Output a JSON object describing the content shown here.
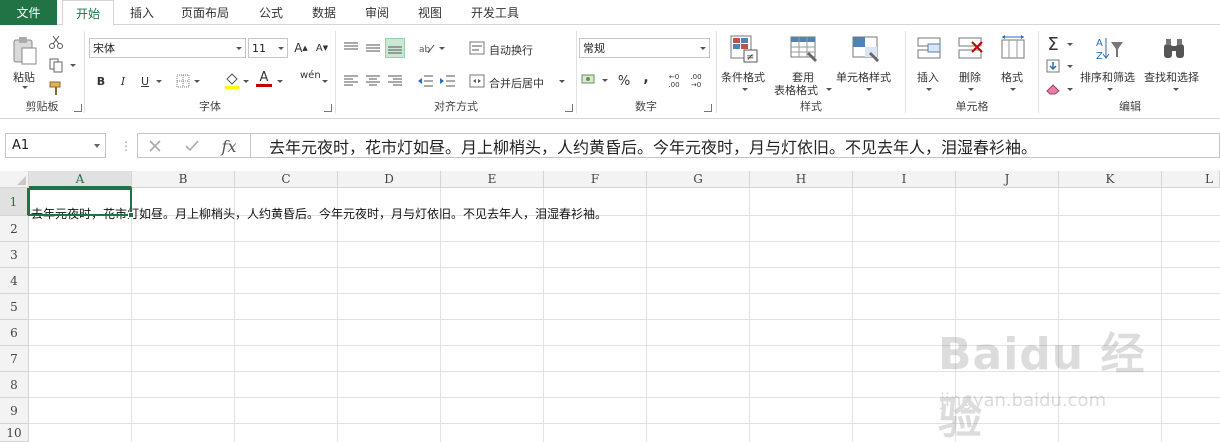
{
  "tabs": {
    "file": "文件",
    "home": "开始",
    "insert": "插入",
    "page_layout": "页面布局",
    "formulas": "公式",
    "data": "数据",
    "review": "审阅",
    "view": "视图",
    "developer": "开发工具"
  },
  "clipboard": {
    "paste": "粘贴",
    "group": "剪贴板"
  },
  "font": {
    "name": "宋体",
    "size": "11",
    "bold": "B",
    "italic": "I",
    "underline": "U",
    "grow": "A",
    "shrink": "A",
    "font_color": "A",
    "phonetic": "wén",
    "group": "字体"
  },
  "alignment": {
    "wrap": "自动换行",
    "merge": "合并后居中",
    "group": "对齐方式"
  },
  "number": {
    "format": "常规",
    "percent": "%",
    "comma": ",",
    "inc_decimal": ".00",
    "dec_decimal": ".00",
    "group": "数字"
  },
  "styles": {
    "conditional": "条件格式",
    "table_line1": "套用",
    "table_line2": "表格格式",
    "cell_styles": "单元格样式",
    "group": "样式"
  },
  "cells": {
    "insert": "插入",
    "delete": "删除",
    "format": "格式",
    "group": "单元格"
  },
  "editing": {
    "sum": "Σ",
    "sort": "排序和筛选",
    "find": "查找和选择",
    "group": "编辑"
  },
  "formula_bar": {
    "name_box": "A1",
    "fx": "fx",
    "content": "去年元夜时，花市灯如昼。月上柳梢头，人约黄昏后。今年元夜时，月与灯依旧。不见去年人，泪湿春衫袖。"
  },
  "grid": {
    "columns": [
      "A",
      "B",
      "C",
      "D",
      "E",
      "F",
      "G",
      "H",
      "I",
      "J",
      "K",
      "L"
    ],
    "rows": [
      "1",
      "2",
      "3",
      "4",
      "5",
      "6",
      "7",
      "8",
      "9",
      "10"
    ],
    "selected_cell": "A1",
    "a1_value": "去年元夜时，花市灯如昼。月上柳梢头，人约黄昏后。今年元夜时，月与灯依旧。不见去年人，泪湿春衫袖。"
  },
  "watermark": {
    "logo": "Baidu 经验",
    "url": "jingyan.baidu.com"
  },
  "colors": {
    "accent": "#217346"
  }
}
